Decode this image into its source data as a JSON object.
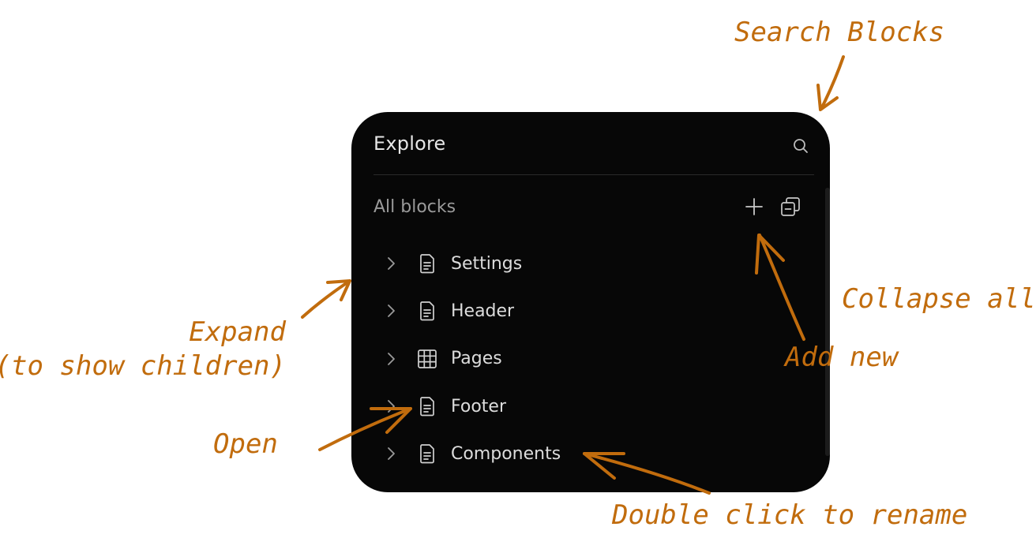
{
  "panel": {
    "title": "Explore",
    "section_label": "All blocks",
    "icons": {
      "search": "search-icon",
      "add": "plus-icon",
      "collapse": "collapse-all-icon"
    },
    "items": [
      {
        "label": "Settings",
        "icon": "document-icon"
      },
      {
        "label": "Header",
        "icon": "document-icon"
      },
      {
        "label": "Pages",
        "icon": "table-icon"
      },
      {
        "label": "Footer",
        "icon": "document-icon"
      },
      {
        "label": "Components",
        "icon": "document-icon"
      }
    ]
  },
  "annotations": {
    "search_blocks": "Search Blocks",
    "collapse_all": "Collapse all",
    "add_new": "Add new",
    "expand_line1": "Expand",
    "expand_line2": "(to show children)",
    "open": "Open",
    "rename": "Double click to rename"
  },
  "colors": {
    "panel_bg": "#070707",
    "annotation": "#c16c0d",
    "text_primary": "#dcdcdc",
    "text_muted": "#9a9a9a"
  }
}
